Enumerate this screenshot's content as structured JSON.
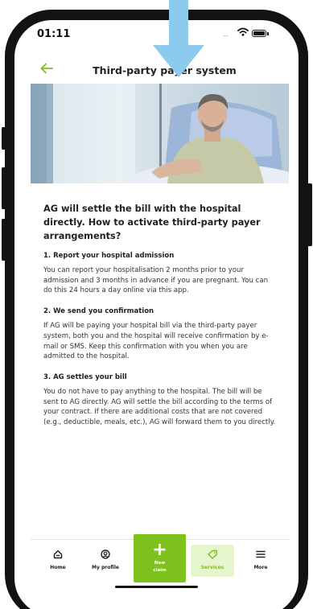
{
  "status_bar": {
    "time": "01:11",
    "signal": "....",
    "wifi_icon": "wifi-icon",
    "battery_icon": "battery-icon"
  },
  "header": {
    "back_icon": "arrow-left-icon",
    "title": "Third-party payer system"
  },
  "hero": {
    "image": "photo of a smiling patient sitting in a hospital bed"
  },
  "content": {
    "lead": "AG will settle the bill with the hospital directly. How to activate third-party payer arrangements?",
    "steps": [
      {
        "heading": "1. Report your hospital admission",
        "body": "You can report your hospitalisation 2 months prior to your admission and 3 months in advance if you are pregnant. You can do this 24 hours a day online via this app."
      },
      {
        "heading": "2. We send you confirmation",
        "body": "If AG will be paying your hospital bill via the third-party payer system, both you and the hospital will receive confirmation by e-mail or SMS. Keep this confirmation with you when you are admitted to the hospital."
      },
      {
        "heading": "3. AG settles your bill",
        "body": "You do not have to pay anything to the hospital. The bill will be sent to AG directly. AG will settle the bill according to the terms of your contract. If there are additional costs that are not covered (e.g., deductible, meals, etc.), AG will forward them to you directly."
      }
    ]
  },
  "nav": {
    "home": {
      "label": "Home",
      "icon": "home-icon"
    },
    "profile": {
      "label": "My profile",
      "icon": "user-circle-icon"
    },
    "new_claim": {
      "label_line1": "New",
      "label_line2": "claim",
      "icon": "plus-icon"
    },
    "services": {
      "label": "Services",
      "icon": "tag-icon",
      "active": true
    },
    "more": {
      "label": "More",
      "icon": "menu-icon"
    }
  },
  "colors": {
    "accent": "#7ec21e",
    "accent_light": "#e6f5cc",
    "overlay_arrow": "#8ccbee",
    "frame": "#121212"
  }
}
